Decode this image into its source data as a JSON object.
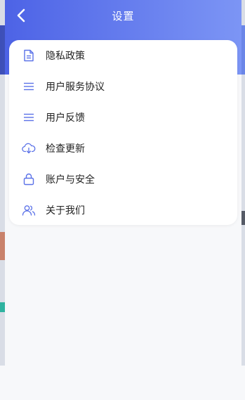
{
  "header": {
    "title": "设置",
    "back_icon": "chevron-left-icon"
  },
  "colors": {
    "header_start": "#4d63e6",
    "header_end": "#7c95f5",
    "icon_accent": "#5b72e8"
  },
  "menu": {
    "items": [
      {
        "label": "隐私政策",
        "icon": "document-icon"
      },
      {
        "label": "用户服务协议",
        "icon": "lines-icon"
      },
      {
        "label": "用户反馈",
        "icon": "lines-icon"
      },
      {
        "label": "检查更新",
        "icon": "cloud-download-icon"
      },
      {
        "label": "账户与安全",
        "icon": "lock-icon"
      },
      {
        "label": "关于我们",
        "icon": "users-icon"
      }
    ]
  }
}
